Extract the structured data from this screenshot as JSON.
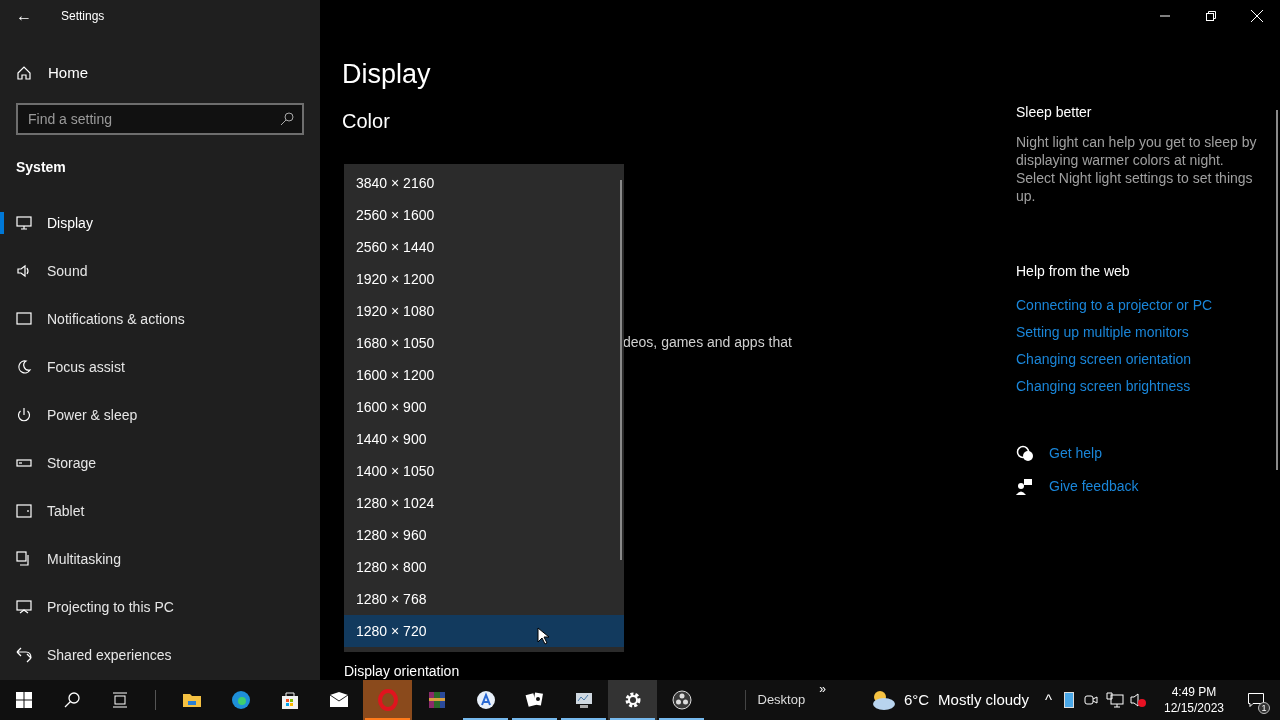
{
  "window": {
    "title": "Settings",
    "back_glyph": "←"
  },
  "sidebar": {
    "home": "Home",
    "search": {
      "placeholder": "Find a setting"
    },
    "section": "System",
    "items": [
      {
        "label": "Display",
        "kind": "display",
        "selected": true
      },
      {
        "label": "Sound",
        "kind": "sound",
        "selected": false
      },
      {
        "label": "Notifications & actions",
        "kind": "notifications",
        "selected": false
      },
      {
        "label": "Focus assist",
        "kind": "focus",
        "selected": false
      },
      {
        "label": "Power & sleep",
        "kind": "power",
        "selected": false
      },
      {
        "label": "Storage",
        "kind": "storage",
        "selected": false
      },
      {
        "label": "Tablet",
        "kind": "tablet",
        "selected": false
      },
      {
        "label": "Multitasking",
        "kind": "multitasking",
        "selected": false
      },
      {
        "label": "Projecting to this PC",
        "kind": "projecting",
        "selected": false
      },
      {
        "label": "Shared experiences",
        "kind": "shared",
        "selected": false
      }
    ]
  },
  "main": {
    "title": "Display",
    "section": "Color",
    "partial_text": "deos, games and apps that",
    "bottom_label": "Display orientation"
  },
  "resolution_dropdown": {
    "options": [
      {
        "label": "3840 × 2160",
        "selected": false
      },
      {
        "label": "2560 × 1600",
        "selected": false
      },
      {
        "label": "2560 × 1440",
        "selected": false
      },
      {
        "label": "1920 × 1200",
        "selected": false
      },
      {
        "label": "1920 × 1080",
        "selected": false
      },
      {
        "label": "1680 × 1050",
        "selected": false
      },
      {
        "label": "1600 × 1200",
        "selected": false
      },
      {
        "label": "1600 × 900",
        "selected": false
      },
      {
        "label": "1440 × 900",
        "selected": false
      },
      {
        "label": "1400 × 1050",
        "selected": false
      },
      {
        "label": "1280 × 1024",
        "selected": false
      },
      {
        "label": "1280 × 960",
        "selected": false
      },
      {
        "label": "1280 × 800",
        "selected": false
      },
      {
        "label": "1280 × 768",
        "selected": false
      },
      {
        "label": "1280 × 720",
        "selected": true
      }
    ]
  },
  "right_panel": {
    "sleep_title": "Sleep better",
    "sleep_text": "Night light can help you get to sleep by displaying warmer colors at night. Select Night light settings to set things up.",
    "help_title": "Help from the web",
    "links": [
      "Connecting to a projector or PC",
      "Setting up multiple monitors",
      "Changing screen orientation",
      "Changing screen brightness"
    ],
    "actions": [
      {
        "label": "Get help",
        "kind": "help"
      },
      {
        "label": "Give feedback",
        "kind": "feedback"
      }
    ]
  },
  "taskbar": {
    "apps": [
      {
        "kind": "explorer",
        "running": false,
        "active": false
      },
      {
        "kind": "edge",
        "running": false,
        "active": false
      },
      {
        "kind": "store",
        "running": false,
        "active": false
      },
      {
        "kind": "mail",
        "running": false,
        "active": false
      },
      {
        "kind": "opera",
        "running": true,
        "active": true
      },
      {
        "kind": "archive",
        "running": false,
        "active": false
      },
      {
        "kind": "appstore",
        "running": true,
        "active": false
      },
      {
        "kind": "cards",
        "running": true,
        "active": false
      },
      {
        "kind": "monitor",
        "running": true,
        "active": false
      },
      {
        "kind": "settings",
        "running": true,
        "active": true
      },
      {
        "kind": "obs",
        "running": true,
        "active": false
      }
    ],
    "desktop_label": "Desktop",
    "more_glyph": "»",
    "temperature": "6°C",
    "weather": "Mostly cloudy",
    "tray_glyph": "^",
    "time": "4:49 PM",
    "date": "12/15/2023",
    "notification_count": "1"
  }
}
